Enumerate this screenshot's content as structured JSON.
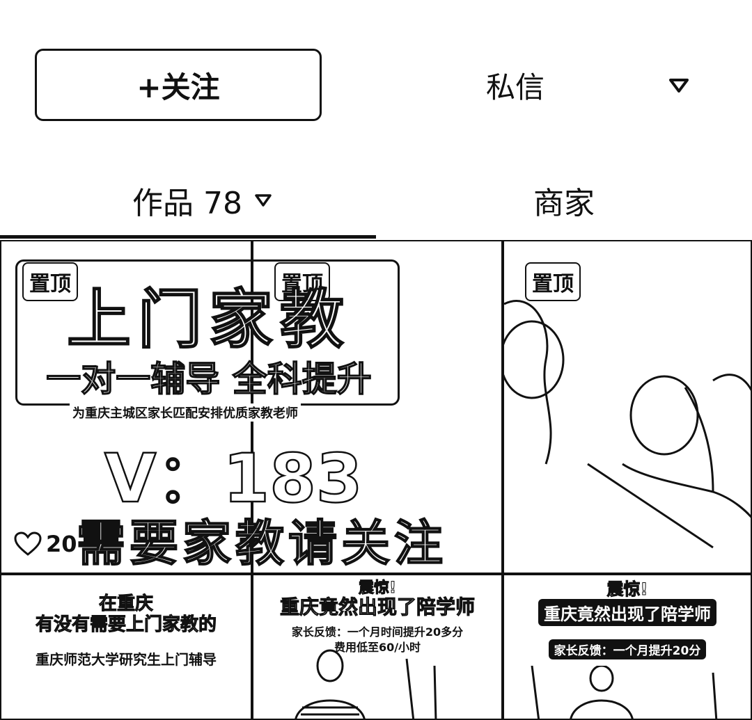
{
  "header": {
    "follow_label": "+关注",
    "message_label": "私信"
  },
  "tabs": [
    {
      "label": "作品 78",
      "active": true
    },
    {
      "label": "商家",
      "active": false
    }
  ],
  "videos": [
    {
      "pinned": true,
      "pin_label": "置顶",
      "title": "上门家教",
      "subtitle": "一对一辅导 全科提升",
      "caption": "为重庆主城区家长匹配安排优质家教老师",
      "contact": "V：183",
      "banner": "需要家教请关注",
      "likes": "20"
    },
    {
      "pinned": true,
      "pin_label": "置顶"
    },
    {
      "pinned": true,
      "pin_label": "置顶"
    },
    {
      "line1": "在重庆",
      "line2": "有没有需要上门家教的",
      "line3": "重庆师范大学研究生上门辅导"
    },
    {
      "headline": "震惊!",
      "title": "重庆竟然出现了陪学师",
      "line1": "家长反馈：一个月时间提升20多分",
      "line2": "费用低至60/小时"
    },
    {
      "headline": "震惊!",
      "title": "重庆竟然出现了陪学师",
      "badge": "家长反馈：一个月提升20分"
    }
  ],
  "colors": {
    "text": "#111111",
    "background": "#ffffff"
  }
}
